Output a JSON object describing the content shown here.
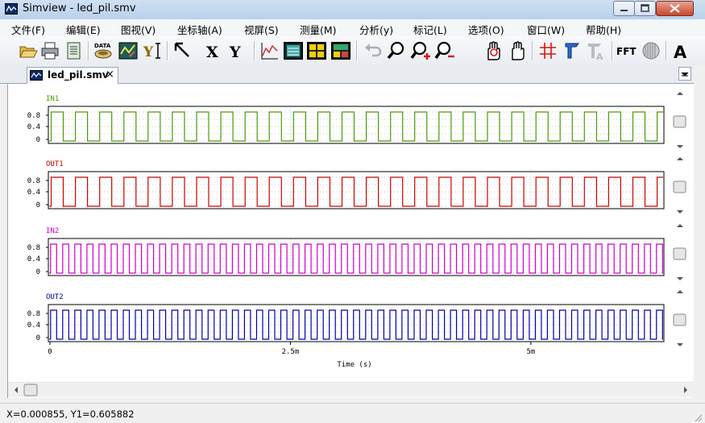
{
  "window": {
    "title": "Simview - led_pil.smv",
    "app_icon": "waveform-app-icon",
    "caption_buttons": [
      "minimize",
      "maximize",
      "close"
    ]
  },
  "menu": [
    "文件(F)",
    "编辑(E)",
    "图视(V)",
    "坐标轴(A)",
    "视屏(S)",
    "测量(M)",
    "分析(y)",
    "标记(L)",
    "选项(O)",
    "窗口(W)",
    "帮助(H)"
  ],
  "toolbar": {
    "x_label": "X",
    "y_label": "Y",
    "fft_label": "FFT",
    "font_label": "A",
    "data_label": "DATA"
  },
  "tab": {
    "label": "led_pil.smv",
    "close": "×"
  },
  "plots": [
    {
      "name": "IN1",
      "color": "#4e9a06",
      "period_ms": 0.252,
      "ticks": [
        "0.8",
        "0.4",
        "0"
      ]
    },
    {
      "name": "OUT1",
      "color": "#cc0000",
      "period_ms": 0.252,
      "ticks": [
        "0.8",
        "0.4",
        "0"
      ]
    },
    {
      "name": "IN2",
      "color": "#cc00cc",
      "period_ms": 0.126,
      "ticks": [
        "0.8",
        "0.4",
        "0"
      ]
    },
    {
      "name": "OUT2",
      "color": "#0000aa",
      "period_ms": 0.126,
      "ticks": [
        "0.8",
        "0.4",
        "0"
      ]
    }
  ],
  "x_axis": {
    "label": "Time (s)",
    "ticks": [
      "0",
      "2.5m",
      "5m"
    ],
    "range_ms": [
      0,
      6.4
    ]
  },
  "status": "X=0.000855, Y1=0.605882"
}
